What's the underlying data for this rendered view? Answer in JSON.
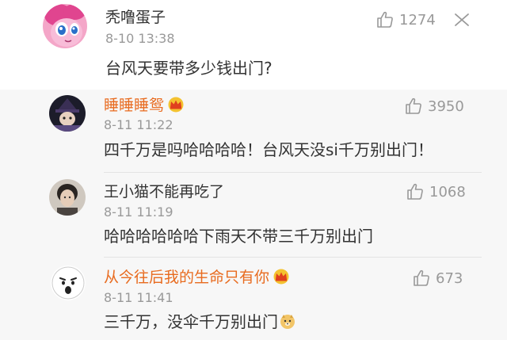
{
  "main": {
    "username": "秃噜蛋子",
    "timestamp": "8-10 13:38",
    "text": "台风天要带多少钱出门?",
    "likes": "1274"
  },
  "replies": [
    {
      "username": "睡睡睡鸳",
      "vip": true,
      "timestamp": "8-11 11:22",
      "text": "四千万是吗哈哈哈哈！台风天没si千万别出门！",
      "likes": "3950"
    },
    {
      "username": "王小猫不能再吃了",
      "vip": false,
      "timestamp": "8-11 11:19",
      "text": "哈哈哈哈哈哈下雨天不带三千万别出门",
      "likes": "1068"
    },
    {
      "username": "从今往后我的生命只有你",
      "vip": true,
      "timestamp": "8-11 11:41",
      "text": "三千万，没伞千万别出门",
      "likes": "673"
    }
  ],
  "icons": {
    "like": "thumbs-up-icon",
    "more": "close-x-icon",
    "vip": "crown-badge-icon",
    "emoji": "doge-emoji-icon"
  },
  "colors": {
    "vip_name": "#e86b1f",
    "timestamp": "#999999",
    "reply_bg": "#f7f7f7"
  }
}
